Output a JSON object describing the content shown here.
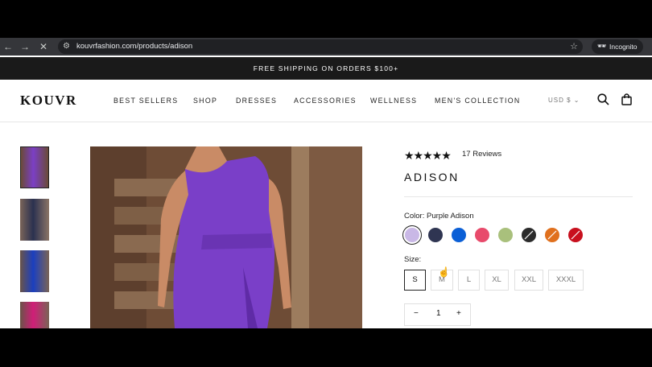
{
  "browser": {
    "url": "kouvrfashion.com/products/adison",
    "mode_label": "Incognito",
    "back_icon": "arrow-left-icon",
    "forward_icon": "arrow-right-icon",
    "stop_icon": "close-icon"
  },
  "announcement": "FREE SHIPPING ON ORDERS $100+",
  "header": {
    "logo": "KOUVR",
    "menu": [
      "BEST SELLERS",
      "SHOP",
      "DRESSES",
      "ACCESSORIES",
      "WELLNESS",
      "MEN'S COLLECTION"
    ],
    "currency": "USD $",
    "icons": [
      "search-icon",
      "bag-icon"
    ]
  },
  "product": {
    "rating": 5,
    "stars": "★★★★★",
    "reviews": "17 Reviews",
    "title": "ADISON",
    "color_label": "Color: Purple Adison",
    "colors": [
      "#c9b8e6",
      "#2f3552",
      "#0b5fd6",
      "#e84a6b",
      "#a9c07c",
      "#2b2b2b",
      "#e0701d",
      "#c8101e"
    ],
    "size_label": "Size:",
    "sizes": [
      "S",
      "M",
      "L",
      "XL",
      "XXL",
      "XXXL"
    ],
    "selected_size": "S",
    "quantity": "1",
    "qty_minus": "−",
    "qty_plus": "+"
  },
  "colors": {
    "announcement_bg": "#1a1a1a",
    "text": "#111111",
    "dress_purple": "#7a3fc8"
  }
}
